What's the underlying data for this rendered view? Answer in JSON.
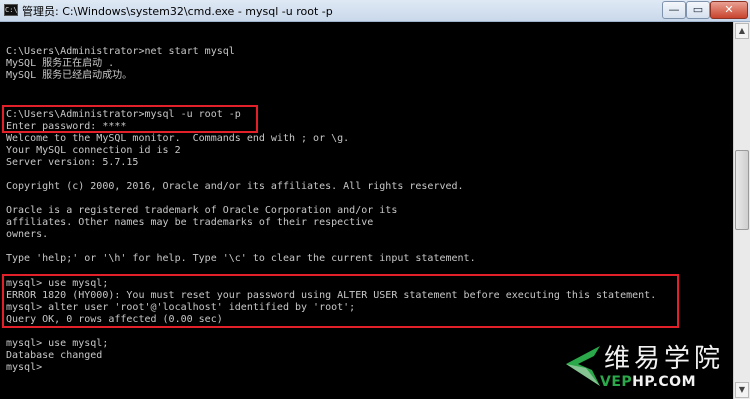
{
  "window": {
    "icon_text": "C:\\",
    "title": "管理员: C:\\Windows\\system32\\cmd.exe - mysql  -u root -p",
    "buttons": {
      "minimize": "—",
      "maximize": "▭",
      "close": "✕"
    }
  },
  "console": {
    "lines": [
      "C:\\Users\\Administrator>net start mysql",
      "MySQL 服务正在启动 .",
      "MySQL 服务已经启动成功。",
      "",
      "",
      "C:\\Users\\Administrator>mysql -u root -p",
      "Enter password: ****",
      "Welcome to the MySQL monitor.  Commands end with ; or \\g.",
      "Your MySQL connection id is 2",
      "Server version: 5.7.15",
      "",
      "Copyright (c) 2000, 2016, Oracle and/or its affiliates. All rights reserved.",
      "",
      "Oracle is a registered trademark of Oracle Corporation and/or its",
      "affiliates. Other names may be trademarks of their respective",
      "owners.",
      "",
      "Type 'help;' or '\\h' for help. Type '\\c' to clear the current input statement.",
      "",
      "mysql> use mysql;",
      "ERROR 1820 (HY000): You must reset your password using ALTER USER statement before executing this statement.",
      "mysql> alter user 'root'@'localhost' identified by 'root';",
      "Query OK, 0 rows affected (0.00 sec)",
      "",
      "mysql> use mysql;",
      "Database changed",
      "mysql>"
    ]
  },
  "scrollbar": {
    "up_arrow": "▲",
    "down_arrow": "▼"
  },
  "watermark": {
    "title": "维易学院",
    "url_prefix": "VEP",
    "url_rest": "HP.COM",
    "logo_colors": {
      "green": "#2aa84a",
      "light": "#cfd8d0"
    }
  },
  "highlight_color": "#e2202a"
}
